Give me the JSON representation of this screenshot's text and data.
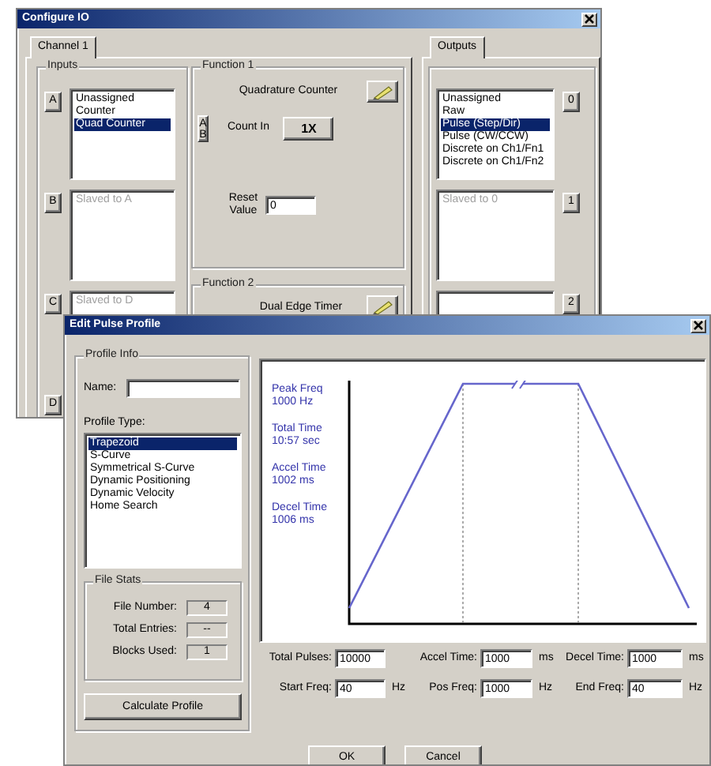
{
  "configure_window": {
    "title": "Configure IO",
    "channel_tabs": [
      {
        "label": "Channel 1",
        "selected": true
      }
    ],
    "inputs": {
      "title": "Inputs",
      "channels": [
        {
          "kind": "list",
          "button": "A",
          "items": [
            {
              "label": "Unassigned",
              "selected": false,
              "disabled": false
            },
            {
              "label": "Counter",
              "selected": false,
              "disabled": false
            },
            {
              "label": "Quad Counter",
              "selected": true,
              "disabled": false
            }
          ]
        },
        {
          "kind": "list",
          "button": "B",
          "items": [
            {
              "label": "Slaved to A",
              "selected": false,
              "disabled": true
            }
          ]
        },
        {
          "kind": "list",
          "button": "C",
          "items": [
            {
              "label": "Slaved to D",
              "selected": false,
              "disabled": true
            }
          ]
        },
        {
          "kind": "button_only",
          "button": "D"
        }
      ]
    },
    "function_1": {
      "title": "Function 1",
      "mode": "Quadrature Counter",
      "input_button": [
        "A",
        "B"
      ],
      "count_in_label": "Count In",
      "count_in_button": "1X",
      "reset_label": "Reset Value",
      "reset_value": "0"
    },
    "function_2": {
      "title": "Function 2",
      "mode": "Dual Edge Timer"
    },
    "output_tabs": [
      {
        "label": "Outputs",
        "selected": true
      }
    ],
    "outputs": {
      "channels": [
        {
          "kind": "list",
          "button": "0",
          "items": [
            {
              "label": "Unassigned",
              "selected": false,
              "disabled": false
            },
            {
              "label": "Raw",
              "selected": false,
              "disabled": false
            },
            {
              "label": "Pulse (Step/Dir)",
              "selected": true,
              "disabled": false
            },
            {
              "label": "Pulse (CW/CCW)",
              "selected": false,
              "disabled": false
            },
            {
              "label": "Discrete on Ch1/Fn1",
              "selected": false,
              "disabled": false
            },
            {
              "label": "Discrete on Ch1/Fn2",
              "selected": false,
              "disabled": false
            }
          ]
        },
        {
          "kind": "list",
          "button": "1",
          "items": [
            {
              "label": "Slaved to 0",
              "selected": false,
              "disabled": true
            }
          ]
        },
        {
          "kind": "list",
          "button": "2"
        }
      ]
    }
  },
  "profile_window": {
    "title": "Edit Pulse Profile",
    "profile_info": {
      "title": "Profile Info",
      "name_label": "Name:",
      "profile_type_label": "Profile Type:",
      "profile_types": [
        {
          "label": "Trapezoid",
          "selected": true
        },
        {
          "label": "S-Curve",
          "selected": false
        },
        {
          "label": "Symmetrical S-Curve",
          "selected": false
        },
        {
          "label": "Dynamic Positioning",
          "selected": false
        },
        {
          "label": "Dynamic Velocity",
          "selected": false
        },
        {
          "label": "Home Search",
          "selected": false
        }
      ]
    },
    "file_stats": {
      "title": "File Stats",
      "rows": [
        {
          "label": "File Number:",
          "value": "4"
        },
        {
          "label": "Total Entries:",
          "value": "--"
        },
        {
          "label": "Blocks Used:",
          "value": "1"
        }
      ]
    },
    "calculate_button": "Calculate Profile",
    "readouts": [
      {
        "label": "Peak Freq",
        "value": "1000 Hz"
      },
      {
        "label": "Total Time",
        "value": "10:57 sec"
      },
      {
        "label": "Accel Time",
        "value": "1002 ms"
      },
      {
        "label": "Decel Time",
        "value": "1006 ms"
      }
    ],
    "parameters": [
      {
        "label": "Total Pulses:",
        "value": "10000"
      },
      {
        "label": "Accel Time:",
        "value": "1000",
        "unit": "ms"
      },
      {
        "label": "Decel Time:",
        "value": "1000",
        "unit": "ms"
      },
      {
        "label": "Start Freq:",
        "value": "40",
        "unit": "Hz"
      },
      {
        "label": "Pos Freq:",
        "value": "1000",
        "unit": "Hz"
      },
      {
        "label": "End Freq:",
        "value": "40",
        "unit": "Hz"
      }
    ],
    "buttons": [
      "OK",
      "Cancel"
    ]
  }
}
